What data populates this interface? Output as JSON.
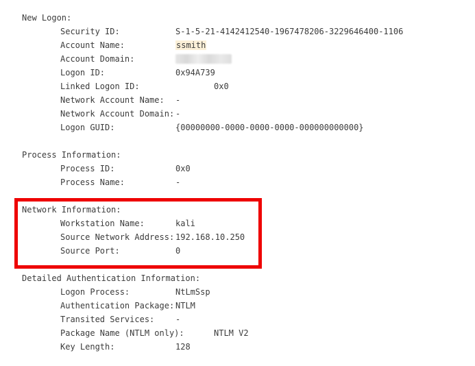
{
  "new_logon": {
    "title": "New Logon:",
    "security_id_label": "Security ID:",
    "security_id": "S-1-5-21-4142412540-1967478206-3229646400-1106",
    "account_name_label": "Account Name:",
    "account_name": "ssmith",
    "account_domain_label": "Account Domain:",
    "logon_id_label": "Logon ID:",
    "logon_id": "0x94A739",
    "linked_logon_id_label": "Linked Logon ID:",
    "linked_logon_id": "0x0",
    "network_account_name_label": "Network Account Name:",
    "network_account_name": "-",
    "network_account_domain_label": "Network Account Domain:",
    "network_account_domain": "-",
    "logon_guid_label": "Logon GUID:",
    "logon_guid": "{00000000-0000-0000-0000-000000000000}"
  },
  "process_information": {
    "title": "Process Information:",
    "process_id_label": "Process ID:",
    "process_id": "0x0",
    "process_name_label": "Process Name:",
    "process_name": "-"
  },
  "network_information": {
    "title": "Network Information:",
    "workstation_name_label": "Workstation Name:",
    "workstation_name": "kali",
    "source_network_address_label": "Source Network Address:",
    "source_network_address": "192.168.10.250",
    "source_port_label": "Source Port:",
    "source_port": "0"
  },
  "detailed_authentication": {
    "title": "Detailed Authentication Information:",
    "logon_process_label": "Logon Process:",
    "logon_process": "NtLmSsp",
    "authentication_package_label": "Authentication Package:",
    "authentication_package": "NTLM",
    "transited_services_label": "Transited Services:",
    "transited_services": "-",
    "package_name_label": "Package Name (NTLM only):",
    "package_name": "NTLM V2",
    "key_length_label": "Key Length:",
    "key_length": "128"
  },
  "colors": {
    "text": "#3b3b3b",
    "highlight": "#fbf0d8",
    "annotation_box": "#ee0000"
  }
}
